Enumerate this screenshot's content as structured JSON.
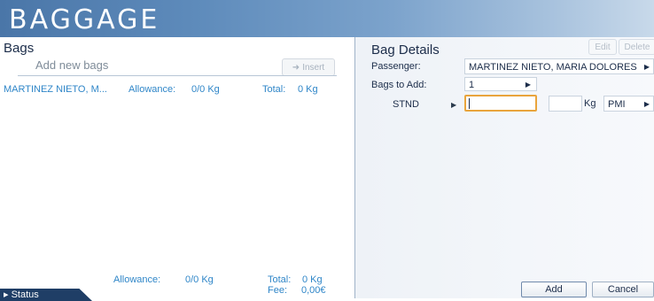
{
  "header": {
    "title": "BAGGAGE"
  },
  "bags": {
    "title": "Bags",
    "add_placeholder": "Add new bags",
    "insert_label": "Insert",
    "row": {
      "name": "MARTINEZ NIETO, M...",
      "allowance_label": "Allowance:",
      "allowance_value": "0/0 Kg",
      "total_label": "Total:",
      "total_value": "0 Kg"
    },
    "footer": {
      "allowance_label": "Allowance:",
      "allowance_value": "0/0 Kg",
      "total_label": "Total:",
      "total_value": "0 Kg",
      "fee_label": "Fee:",
      "fee_value": "0,00€"
    },
    "status_label": "Status"
  },
  "details": {
    "title": "Bag Details",
    "edit_label": "Edit",
    "delete_label": "Delete",
    "passenger_label": "Passenger:",
    "passenger_value": "MARTINEZ NIETO, MARIA DOLORES",
    "bags_to_add_label": "Bags to Add:",
    "bags_to_add_value": "1",
    "stnd_label": "STND",
    "weight_value": "",
    "kg_label": "Kg",
    "destination_value": "PMI",
    "add_label": "Add",
    "cancel_label": "Cancel"
  },
  "colors": {
    "header": "#4a76a8",
    "link_blue": "#2f86c8",
    "focus_orange": "#e9a43c",
    "status_tab": "#1f3e66"
  }
}
